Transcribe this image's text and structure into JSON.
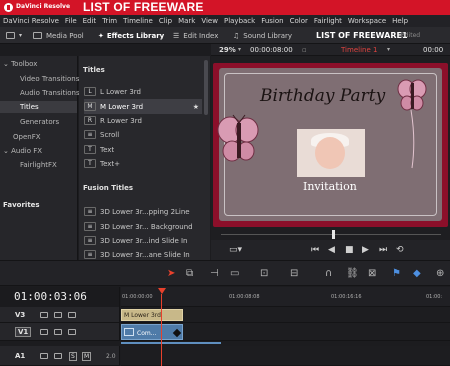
{
  "app": {
    "small_title": "DaVinci Resolve",
    "banner": "LIST OF FREEWARE"
  },
  "menu": [
    "DaVinci Resolve",
    "File",
    "Edit",
    "Trim",
    "Timeline",
    "Clip",
    "Mark",
    "View",
    "Playback",
    "Fusion",
    "Color",
    "Fairlight",
    "Workspace",
    "Help"
  ],
  "toolbar": {
    "media_pool": "Media Pool",
    "effects_library": "Effects Library",
    "edit_index": "Edit Index",
    "sound_library": "Sound Library",
    "project_name": "LIST OF FREEWARE1",
    "project_status": "Edited"
  },
  "viewer_header": {
    "zoom": "29%",
    "timecode": "00:00:08:00",
    "timeline_name": "Timeline 1",
    "right_timecode": "00:00"
  },
  "tree": {
    "toolbox": "Toolbox",
    "video_transitions": "Video Transitions",
    "audio_transitions": "Audio Transitions",
    "titles": "Titles",
    "generators": "Generators",
    "openfx": "OpenFX",
    "audio_fx": "Audio FX",
    "fairlight_fx": "FairlightFX",
    "favorites": "Favorites"
  },
  "titles_section": {
    "heading": "Titles",
    "items": [
      {
        "badge": "L",
        "label": "L Lower 3rd"
      },
      {
        "badge": "M",
        "label": "M Lower 3rd"
      },
      {
        "badge": "R",
        "label": "R Lower 3rd"
      },
      {
        "badge": "",
        "label": "Scroll"
      },
      {
        "badge": "T",
        "label": "Text"
      },
      {
        "badge": "T",
        "label": "Text+"
      }
    ],
    "fav_star": "★"
  },
  "fusion_section": {
    "heading": "Fusion Titles",
    "items": [
      {
        "label": "3D Lower 3r...pping 2Line"
      },
      {
        "label": "3D Lower 3r... Background"
      },
      {
        "label": "3D Lower 3r...ind Slide In"
      },
      {
        "label": "3D Lower 3r...ane Slide In"
      }
    ]
  },
  "preview": {
    "title": "Birthday Party",
    "subtitle": "Invitation"
  },
  "timeline": {
    "timecode": "01:00:03:06",
    "ticks": [
      "01:00:00:00",
      "01:00:08:08",
      "01:00:16:16",
      "01:00:"
    ],
    "tracks": [
      {
        "name": "V3"
      },
      {
        "name": "V1"
      },
      {
        "name": "A1",
        "solo": "S",
        "mute": "M",
        "level": "2.0"
      }
    ],
    "clip_title": "M Lower 3rd",
    "clip_video": "Com..."
  },
  "colors": {
    "title_bar": "#d31427",
    "playhead": "#e8412c",
    "title_clip": "#c8b889",
    "video_clip": "#4f7ba8",
    "card_border": "#8c0f2a"
  }
}
